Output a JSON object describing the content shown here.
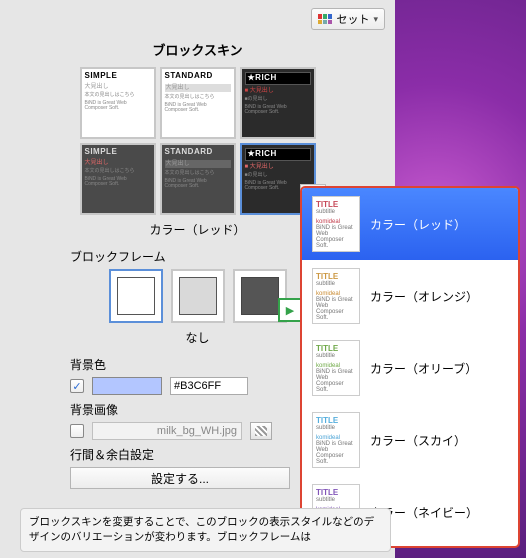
{
  "topbar": {
    "set_label": "セット"
  },
  "sections": {
    "blockskin_title": "ブロックスキン",
    "blockframe_label": "ブロックフレーム",
    "frame_caption": "なし",
    "bgcolor_label": "背景色",
    "bgimage_label": "背景画像",
    "lineheight_label": "行間＆余白設定",
    "config_button": "設定する..."
  },
  "skins": {
    "caption": "カラー（レッド）",
    "cards": [
      {
        "head": "SIMPLE",
        "sub": "大見出し",
        "desc": "本文の見出しはこちら",
        "meta": "BiND is Great Web Composer Soft."
      },
      {
        "head": "STANDARD",
        "sub": "大見出し",
        "desc": "本文の見出しはこちら",
        "meta": "BiND is Great Web Composer Soft."
      },
      {
        "head": "★RICH",
        "sub": "■ 大見出し",
        "desc": "■の見出し",
        "meta": "BiND is Great Web Composer Soft."
      },
      {
        "head": "SIMPLE",
        "sub": "大見出し",
        "desc": "本文の見出しはこちら",
        "meta": "BiND is Great Web Composer Soft."
      },
      {
        "head": "STANDARD",
        "sub": "大見出し",
        "desc": "本文の見出しはこちら",
        "meta": "BiND is Great Web Composer Soft."
      },
      {
        "head": "★RICH",
        "sub": "■ 大見出し",
        "desc": "■の見出し",
        "meta": "BiND is Great Web Composer Soft."
      }
    ]
  },
  "bgcolor": {
    "checked": true,
    "hex": "#B3C6FF"
  },
  "bgimage": {
    "checked": false,
    "filename": "milk_bg_WH.jpg"
  },
  "flyout": {
    "items": [
      {
        "label": "カラー（レッド）",
        "accent": "#c23b4a",
        "title_color": "#c64a59",
        "selected": true
      },
      {
        "label": "カラー（オレンジ）",
        "accent": "#c98a2f",
        "title_color": "#cc9944",
        "selected": false
      },
      {
        "label": "カラー（オリーブ）",
        "accent": "#6da844",
        "title_color": "#6fa84a",
        "selected": false
      },
      {
        "label": "カラー（スカイ）",
        "accent": "#4aa3d6",
        "title_color": "#55aedd",
        "selected": false
      },
      {
        "label": "カラー（ネイビー）",
        "accent": "#7a4fb0",
        "title_color": "#8256b8",
        "selected": false
      }
    ],
    "thumb": {
      "title": "TITLE",
      "subtitle": "subtitle",
      "divider": "komideal",
      "meta": "BiND is Great Web Composer Soft."
    }
  },
  "footnote": "ブロックスキンを変更することで、このブロックの表示スタイルなどのデザインのバリエーションが変わります。ブロックフレームは"
}
